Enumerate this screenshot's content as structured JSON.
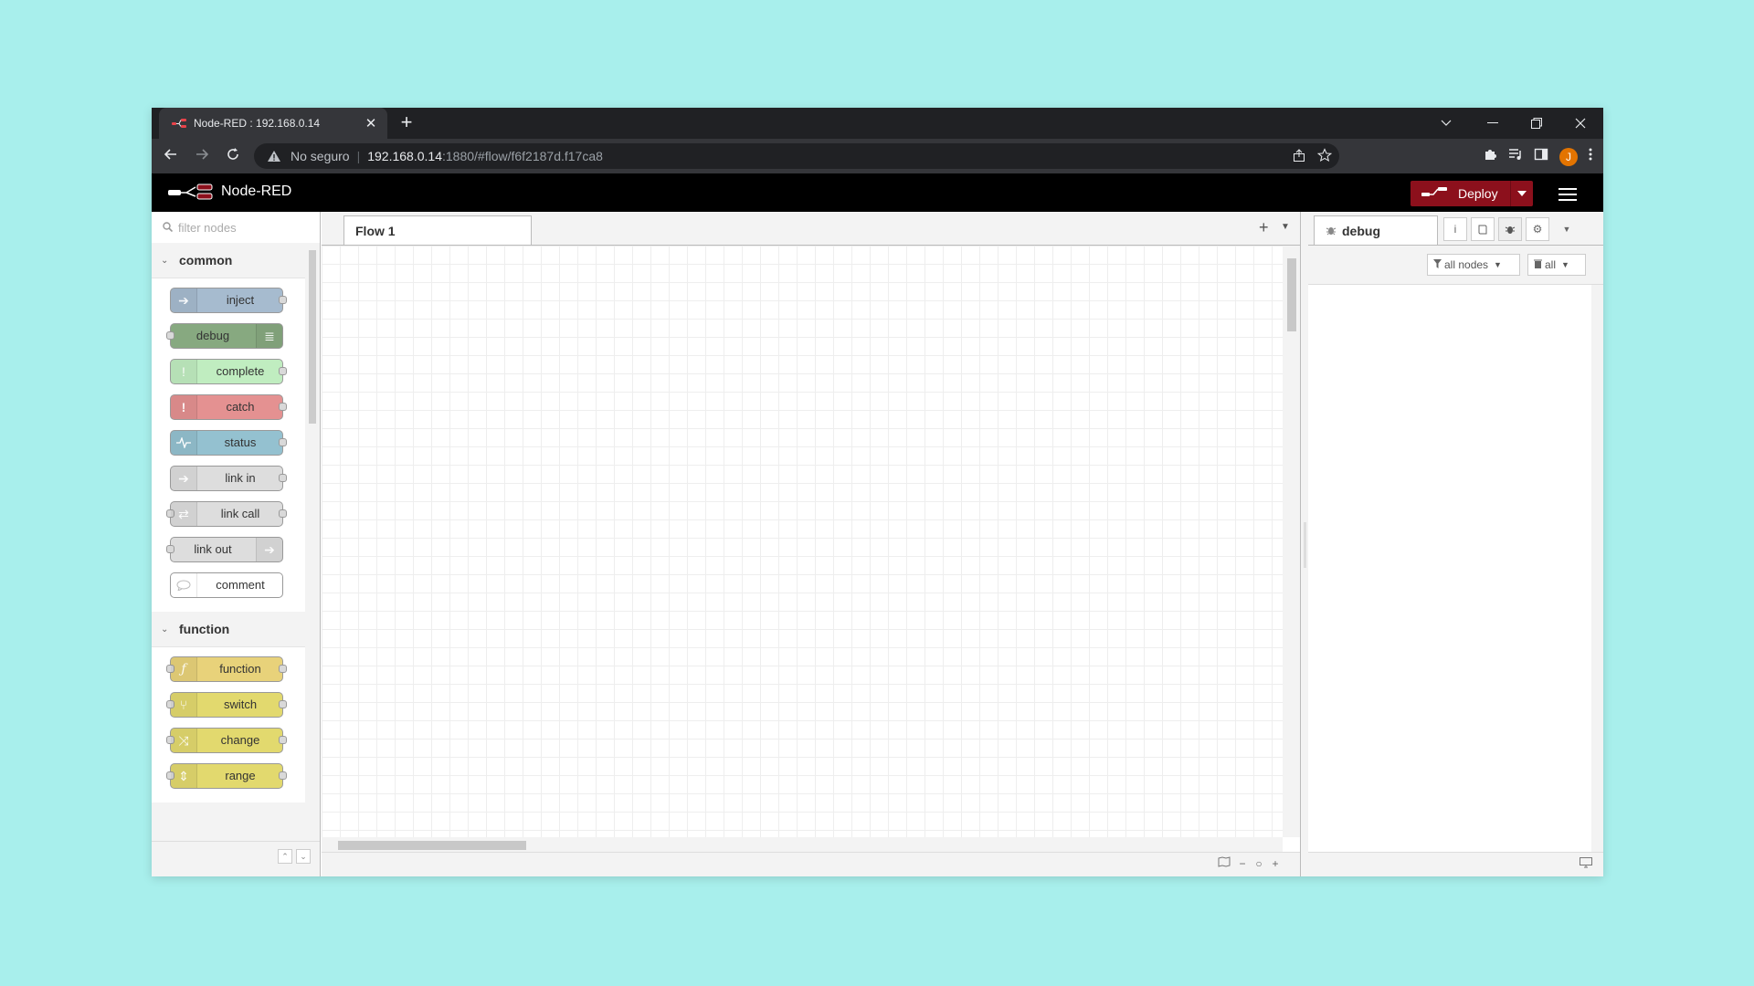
{
  "browser": {
    "tab_title": "Node-RED : 192.168.0.14",
    "close_glyph": "✕",
    "new_tab_glyph": "+",
    "security_label": "No seguro",
    "url_host": "192.168.0.14",
    "url_rest": ":1880/#flow/f6f2187d.f17ca8",
    "avatar_letter": "J"
  },
  "header": {
    "app_name": "Node-RED",
    "deploy_label": "Deploy"
  },
  "palette": {
    "filter_placeholder": "filter nodes",
    "categories": [
      {
        "name": "common",
        "nodes": [
          {
            "label": "inject",
            "color": "#a6bbcf"
          },
          {
            "label": "debug",
            "color": "#87a980"
          },
          {
            "label": "complete",
            "color": "#c0edc0"
          },
          {
            "label": "catch",
            "color": "#e49191"
          },
          {
            "label": "status",
            "color": "#94c1d0"
          },
          {
            "label": "link in",
            "color": "#dddddd"
          },
          {
            "label": "link call",
            "color": "#dddddd"
          },
          {
            "label": "link out",
            "color": "#dddddd"
          },
          {
            "label": "comment",
            "color": "#ffffff"
          }
        ]
      },
      {
        "name": "function",
        "nodes": [
          {
            "label": "function",
            "color": "#fdd0a2"
          },
          {
            "label": "switch",
            "color": "#e2d96e"
          },
          {
            "label": "change",
            "color": "#e2d96e"
          },
          {
            "label": "range",
            "color": "#e2d96e"
          }
        ]
      }
    ]
  },
  "workspace": {
    "tabs": [
      {
        "label": "Flow 1"
      }
    ]
  },
  "sidebar": {
    "active_tab": "debug",
    "filter_label": "all nodes",
    "clear_label": "all"
  }
}
